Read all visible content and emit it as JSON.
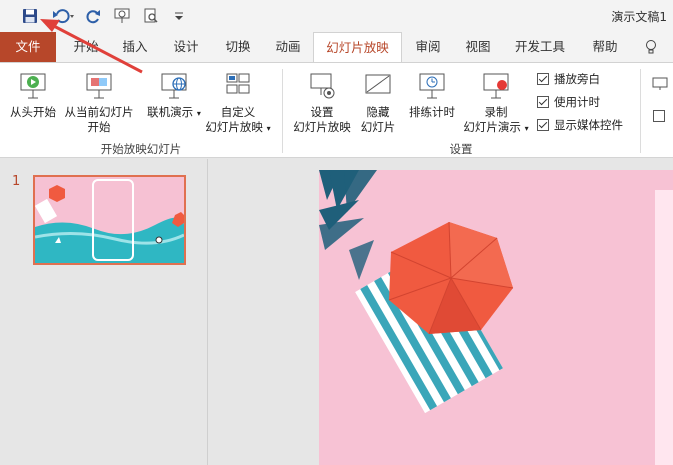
{
  "window": {
    "doc_title": "演示文稿1"
  },
  "quick_access": {
    "save": "save-icon",
    "undo": "undo-icon",
    "redo": "redo-icon",
    "present": "present-from-beginning-icon",
    "preview": "print-preview-icon",
    "customize": "customize-quick-access-icon"
  },
  "tabs": [
    "文件",
    "开始",
    "插入",
    "设计",
    "切换",
    "动画",
    "幻灯片放映",
    "审阅",
    "视图",
    "开发工具",
    "帮助"
  ],
  "active_tab": "幻灯片放映",
  "ribbon": {
    "start_group": {
      "label": "开始放映幻灯片",
      "from_beginning": "从头开始",
      "from_current_1": "从当前幻灯片",
      "from_current_2": "开始",
      "online_present": "联机演示",
      "custom_1": "自定义",
      "custom_2": "幻灯片放映"
    },
    "setup_group": {
      "label": "设置",
      "setup_1": "设置",
      "setup_2": "幻灯片放映",
      "hide_1": "隐藏",
      "hide_2": "幻灯片",
      "rehearse": "排练计时",
      "record_1": "录制",
      "record_2": "幻灯片演示",
      "checkboxes": [
        {
          "label": "播放旁白",
          "checked": true
        },
        {
          "label": "使用计时",
          "checked": true
        },
        {
          "label": "显示媒体控件",
          "checked": true
        }
      ]
    }
  },
  "thumbnails": {
    "number": "1"
  },
  "colors": {
    "accent": "#b7472a",
    "slide_bg": "#f7c2d4",
    "hexagon": "#f05a40",
    "stripe": "#3aa6b9",
    "arrow": "#e0403a"
  }
}
